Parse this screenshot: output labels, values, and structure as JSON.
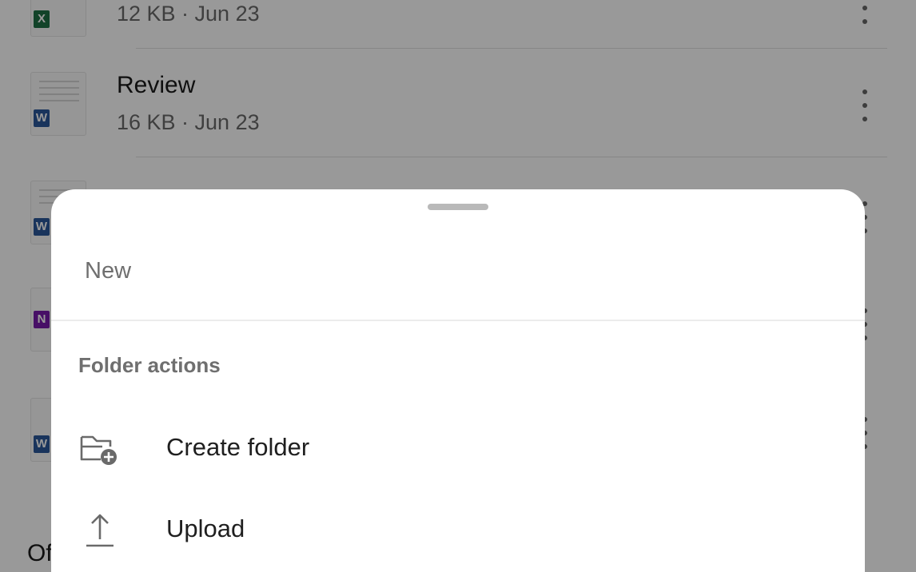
{
  "file_list": {
    "items": [
      {
        "name": "",
        "meta": "12 KB · Jun 23",
        "app": "excel",
        "badge": "X",
        "badge_color": "#1e7145"
      },
      {
        "name": "Review",
        "meta": "16 KB · Jun 23",
        "app": "word",
        "badge": "W",
        "badge_color": "#2b579a"
      },
      {
        "name": "",
        "meta": "",
        "app": "word",
        "badge": "W",
        "badge_color": "#2b579a"
      },
      {
        "name": "",
        "meta": "",
        "app": "onenote",
        "badge": "N",
        "badge_color": "#7719aa"
      },
      {
        "name": "",
        "meta": "",
        "app": "word",
        "badge": "W",
        "badge_color": "#2b579a"
      }
    ],
    "footer_partial": "Of"
  },
  "sheet": {
    "title": "New",
    "section_label": "Folder actions",
    "actions": [
      {
        "label": "Create folder",
        "icon": "folder-add-icon"
      },
      {
        "label": "Upload",
        "icon": "upload-icon"
      }
    ]
  },
  "colors": {
    "scrim": "rgba(0,0,0,0.40)",
    "sheet_background": "#ffffff",
    "secondary_text": "#6f6f6f"
  }
}
